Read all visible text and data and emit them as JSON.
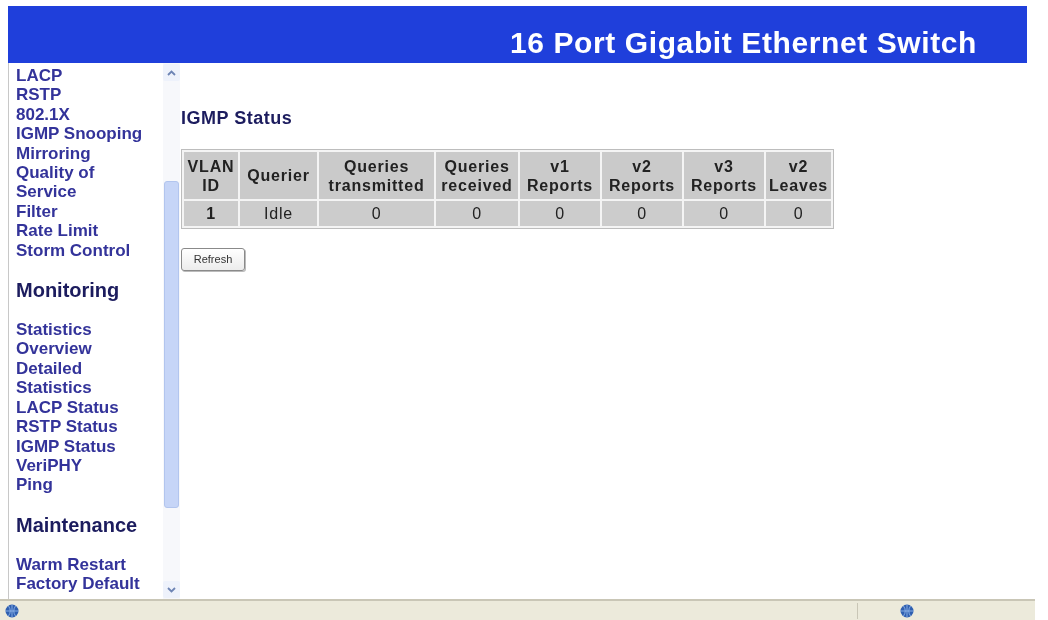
{
  "window": {
    "title": "16 Port Gigabit Ethernet Switch"
  },
  "sidebar": {
    "sections": [
      {
        "items": [
          "LACP",
          "RSTP",
          "802.1X",
          "IGMP Snooping",
          "Mirroring",
          "Quality of Service",
          "Filter",
          "Rate Limit",
          "Storm Control"
        ]
      },
      {
        "heading": "Monitoring",
        "items": [
          "Statistics Overview",
          "Detailed Statistics",
          "LACP Status",
          "RSTP Status",
          "IGMP Status",
          "VeriPHY",
          "Ping"
        ]
      },
      {
        "heading": "Maintenance",
        "items": [
          "Warm Restart",
          "Factory Default"
        ]
      }
    ]
  },
  "content": {
    "heading": "IGMP Status",
    "table": {
      "columns": [
        "VLAN ID",
        "Querier",
        "Queries transmitted",
        "Queries received",
        "v1 Reports",
        "v2 Reports",
        "v3 Reports",
        "v2 Leaves"
      ],
      "rows": [
        [
          "1",
          "Idle",
          "0",
          "0",
          "0",
          "0",
          "0",
          "0"
        ]
      ]
    },
    "buttons": [
      "Refresh"
    ]
  }
}
